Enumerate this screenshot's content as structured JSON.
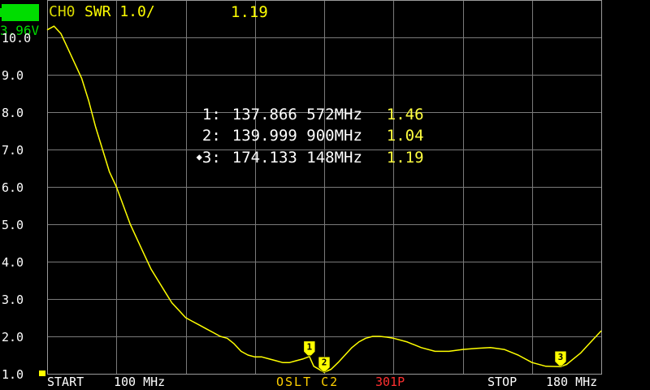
{
  "battery": {
    "voltage": "3.96V",
    "fill_color": "#00dd00",
    "voltage_color": "#00dd00"
  },
  "trace": {
    "channel_label": "CH0",
    "format_label": "SWR 1.0/",
    "current_value": "1.19",
    "color": "#ffff00"
  },
  "y_axis": {
    "labels": [
      "10.0",
      "9.0",
      "8.0",
      "7.0",
      "6.0",
      "5.0",
      "4.0",
      "3.0",
      "2.0",
      "1.0"
    ]
  },
  "markers": [
    {
      "id": "1:",
      "freq": "137.866 572MHz",
      "value": "1.46",
      "active": false
    },
    {
      "id": "2:",
      "freq": "139.999 900MHz",
      "value": "1.04",
      "active": false
    },
    {
      "id": "3:",
      "freq": "174.133 148MHz",
      "value": "1.19",
      "active": true
    }
  ],
  "active_marker_symbol": "◆",
  "footer": {
    "start_label": "START",
    "start_freq": "100 MHz",
    "cal_status": "OSLT C2",
    "points": "301P",
    "stop_label": "STOP",
    "stop_freq": "180 MHz"
  },
  "chart_data": {
    "type": "line",
    "x_unit": "MHz",
    "xlim": [
      100,
      180
    ],
    "ylim": [
      1.0,
      10.0
    ],
    "grid": true,
    "series": [
      {
        "x": [
          100,
          101,
          102,
          103,
          104,
          105,
          106,
          107,
          108,
          109,
          110,
          111,
          112,
          113,
          114,
          115,
          116,
          117,
          118,
          119,
          120,
          121,
          122,
          123,
          124,
          125,
          126,
          127,
          128,
          129,
          130,
          131,
          132,
          133,
          134,
          135,
          136,
          137,
          137.87,
          138.5,
          140,
          141,
          142,
          143,
          144,
          145,
          146,
          147,
          148,
          149,
          150,
          152,
          154,
          156,
          158,
          160,
          162,
          164,
          166,
          168,
          170,
          172,
          174.13,
          175,
          176,
          177,
          178,
          179,
          180
        ],
        "y": [
          10.2,
          10.3,
          10.1,
          9.7,
          9.3,
          8.9,
          8.3,
          7.6,
          7.0,
          6.4,
          6.0,
          5.5,
          5.0,
          4.6,
          4.2,
          3.8,
          3.5,
          3.2,
          2.9,
          2.7,
          2.5,
          2.4,
          2.3,
          2.2,
          2.1,
          2.0,
          1.95,
          1.8,
          1.6,
          1.5,
          1.45,
          1.45,
          1.4,
          1.35,
          1.3,
          1.3,
          1.35,
          1.4,
          1.46,
          1.2,
          1.04,
          1.12,
          1.3,
          1.5,
          1.7,
          1.85,
          1.95,
          2.0,
          2.0,
          1.98,
          1.95,
          1.85,
          1.7,
          1.6,
          1.6,
          1.65,
          1.68,
          1.7,
          1.65,
          1.5,
          1.3,
          1.2,
          1.19,
          1.25,
          1.4,
          1.55,
          1.75,
          1.95,
          2.15
        ]
      }
    ],
    "markers": [
      {
        "label": "1",
        "x": 137.87,
        "y": 1.46
      },
      {
        "label": "2",
        "x": 140.0,
        "y": 1.04
      },
      {
        "label": "3",
        "x": 174.13,
        "y": 1.19
      }
    ]
  }
}
